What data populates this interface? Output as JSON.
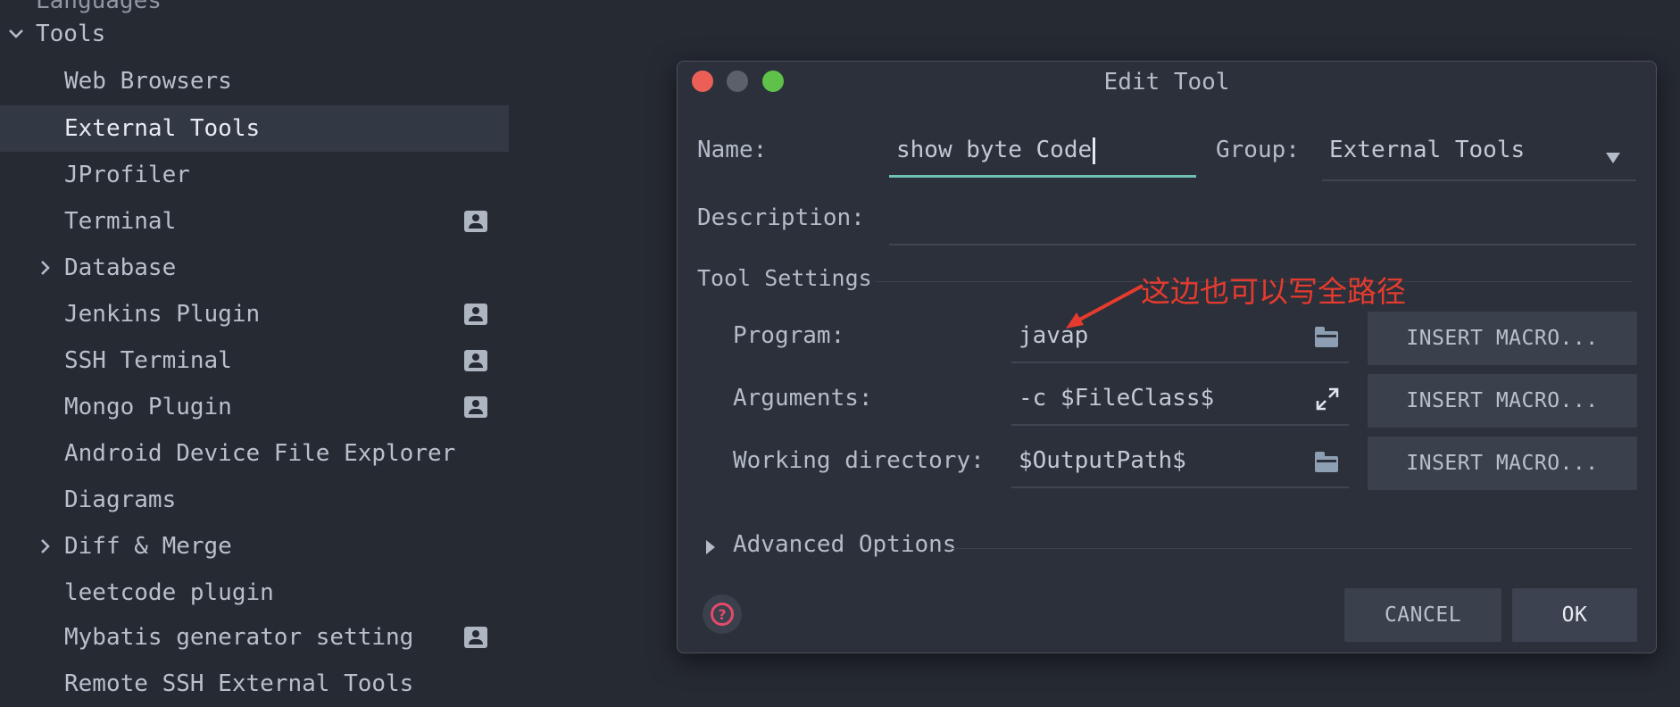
{
  "sidebar": {
    "partial_top": "Languages",
    "tools_label": "Tools",
    "items": [
      {
        "label": "Web Browsers"
      },
      {
        "label": "External Tools"
      },
      {
        "label": "JProfiler"
      },
      {
        "label": "Terminal"
      },
      {
        "label": "Database"
      },
      {
        "label": "Jenkins Plugin"
      },
      {
        "label": "SSH Terminal"
      },
      {
        "label": "Mongo Plugin"
      },
      {
        "label": "Android Device File Explorer"
      },
      {
        "label": "Diagrams"
      },
      {
        "label": "Diff & Merge"
      },
      {
        "label": "leetcode plugin"
      },
      {
        "label": "Mybatis generator setting"
      },
      {
        "label": "Remote SSH External Tools"
      }
    ],
    "icons": {
      "expanded": "chevron-down-icon",
      "collapsed": "chevron-right-icon",
      "project_level": "project-level-icon"
    }
  },
  "dialog": {
    "title": "Edit Tool",
    "name_label": "Name:",
    "name_value": "show byte Code",
    "group_label": "Group:",
    "group_value": "External Tools",
    "description_label": "Description:",
    "description_value": "",
    "tool_settings_label": "Tool Settings",
    "program_label": "Program:",
    "program_value": "javap",
    "arguments_label": "Arguments:",
    "arguments_value": "-c $FileClass$",
    "working_dir_label": "Working directory:",
    "working_dir_value": "$OutputPath$",
    "insert_macro_label": "INSERT MACRO...",
    "advanced_options_label": "Advanced Options",
    "cancel_label": "CANCEL",
    "ok_label": "OK"
  },
  "annotation": {
    "text": "这边也可以写全路径",
    "color": "#e53b2e"
  },
  "colors": {
    "background": "#262a33",
    "dialog_bg": "#2b303a",
    "accent": "#6fc1b8",
    "selected_row": "#333845",
    "help_icon": "#e6496a"
  }
}
